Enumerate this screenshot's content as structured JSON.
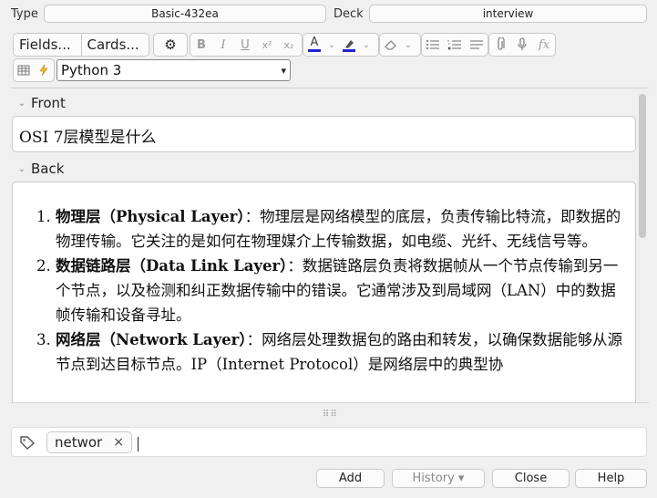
{
  "top": {
    "type_label": "Type",
    "type_value": "Basic-432ea",
    "deck_label": "Deck",
    "deck_value": "interview"
  },
  "toolbar": {
    "fields_label": "Fields...",
    "cards_label": "Cards...",
    "icons": {
      "gear": "gear-icon",
      "bold": "B",
      "italic": "I",
      "underline": "U",
      "superscript": "x²",
      "subscript": "x₂",
      "text_color": "A",
      "highlight": "highlight-icon",
      "eraser": "eraser-icon",
      "bullet_list": "bullet-list-icon",
      "numbered_list": "numbered-list-icon",
      "align": "align-icon",
      "attach": "paperclip-icon",
      "record": "microphone-icon",
      "mathjax": "fx"
    },
    "colors": {
      "text_color": "#2222cc",
      "highlight_color": "#2222cc"
    },
    "language_select": "Python 3"
  },
  "fields": {
    "front_label": "Front",
    "front_value": "OSI 7层模型是什么",
    "back_label": "Back",
    "back_items": [
      {
        "title": "物理层（Physical Layer）",
        "text": "：物理层是网络模型的底层，负责传输比特流，即数据的物理传输。它关注的是如何在物理媒介上传输数据，如电缆、光纤、无线信号等。"
      },
      {
        "title": "数据链路层（Data Link Layer）",
        "text": "：数据链路层负责将数据帧从一个节点传输到另一个节点，以及检测和纠正数据传输中的错误。它通常涉及到局域网（LAN）中的数据帧传输和设备寻址。"
      },
      {
        "title": "网络层（Network Layer）",
        "text": "：网络层处理数据包的路由和转发，以确保数据能够从源节点到达目标节点。IP（Internet Protocol）是网络层中的典型协"
      }
    ]
  },
  "tags": {
    "items": [
      "networ"
    ],
    "remove_glyph": "×"
  },
  "buttons": {
    "add": "Add",
    "history": "History ▾",
    "close": "Close",
    "help": "Help"
  }
}
